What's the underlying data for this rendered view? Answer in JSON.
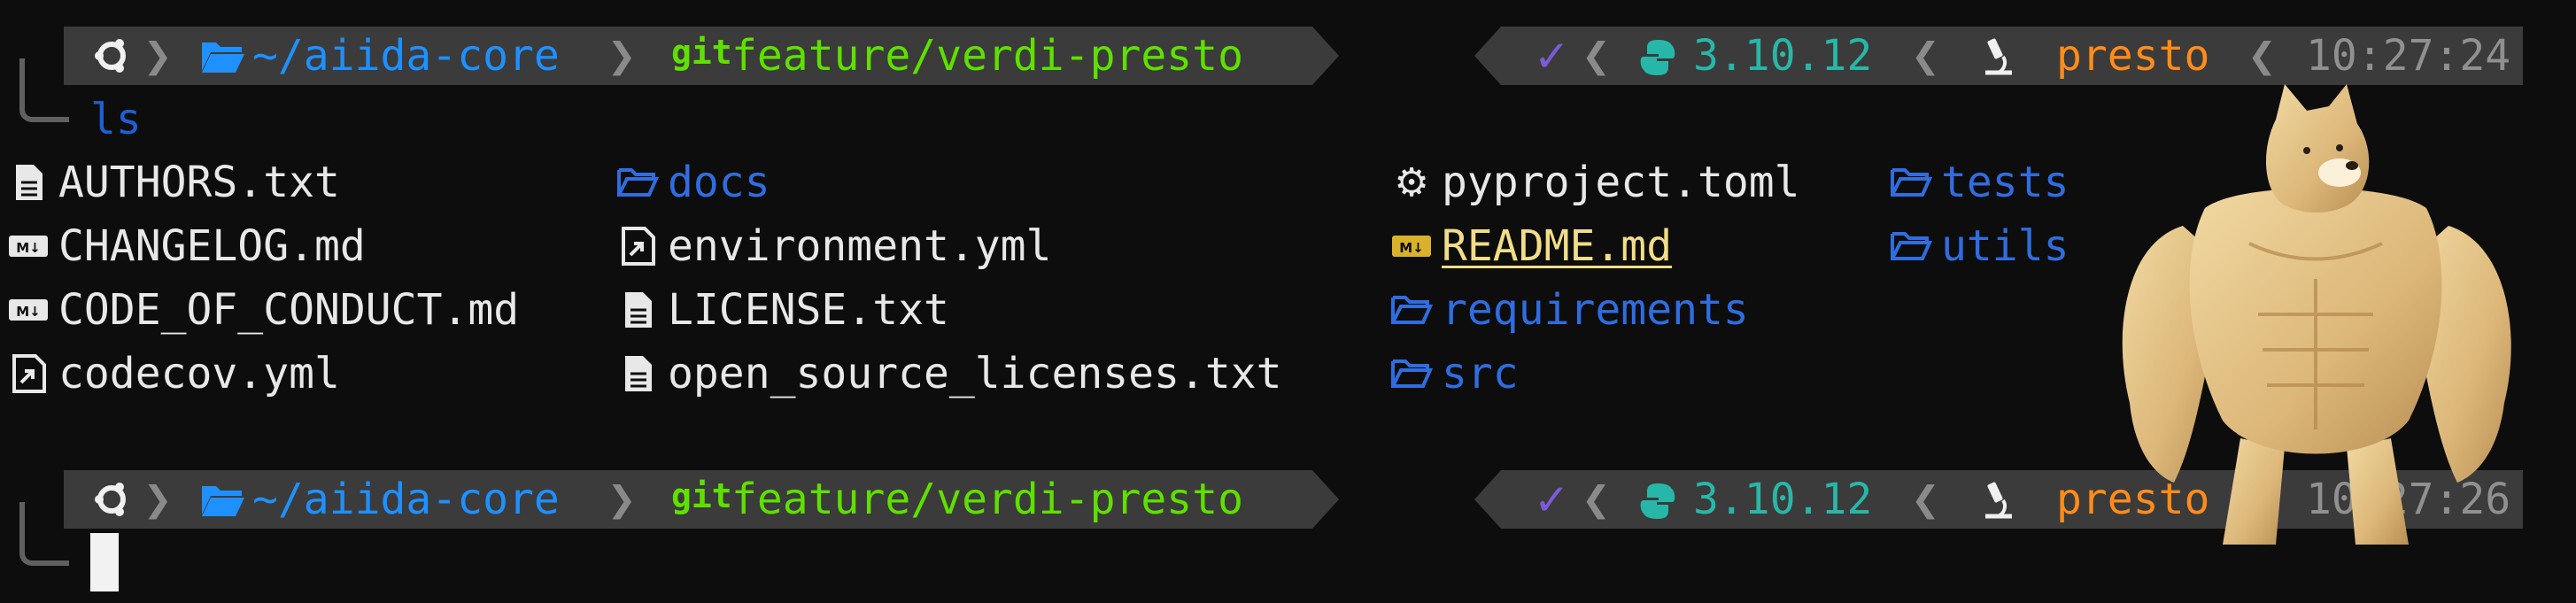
{
  "prompt1": {
    "path": "~/aiida-core",
    "git_label": "git",
    "branch": "feature/verdi-presto",
    "status_check": "✓",
    "python_version": "3.10.12",
    "env_name": "presto",
    "time": "10:27:24"
  },
  "command": "ls",
  "files": [
    {
      "name": "AUTHORS.txt",
      "kind": "text"
    },
    {
      "name": "CHANGELOG.md",
      "kind": "markdown"
    },
    {
      "name": "CODE_OF_CONDUCT.md",
      "kind": "markdown"
    },
    {
      "name": "codecov.yml",
      "kind": "yaml"
    },
    {
      "name": "docs",
      "kind": "folder"
    },
    {
      "name": "environment.yml",
      "kind": "yaml"
    },
    {
      "name": "LICENSE.txt",
      "kind": "text"
    },
    {
      "name": "open_source_licenses.txt",
      "kind": "text"
    },
    {
      "name": "pyproject.toml",
      "kind": "config"
    },
    {
      "name": "README.md",
      "kind": "readme"
    },
    {
      "name": "requirements",
      "kind": "folder"
    },
    {
      "name": "src",
      "kind": "folder"
    },
    {
      "name": "tests",
      "kind": "folder"
    },
    {
      "name": "utils",
      "kind": "folder"
    }
  ],
  "prompt2": {
    "path": "~/aiida-core",
    "git_label": "git",
    "branch": "feature/verdi-presto",
    "status_check": "✓",
    "python_version": "3.10.12",
    "env_name": "presto",
    "time": "10:27:26"
  },
  "colors": {
    "background": "#0d0d0d",
    "segment": "#3b3b3b",
    "path": "#1e90ff",
    "branch": "#5ee000",
    "check": "#7b5bd8",
    "python": "#27b7a8",
    "env": "#ff8c1a",
    "time": "#909090",
    "folder": "#2f6de0",
    "readme": "#f2dd88"
  }
}
